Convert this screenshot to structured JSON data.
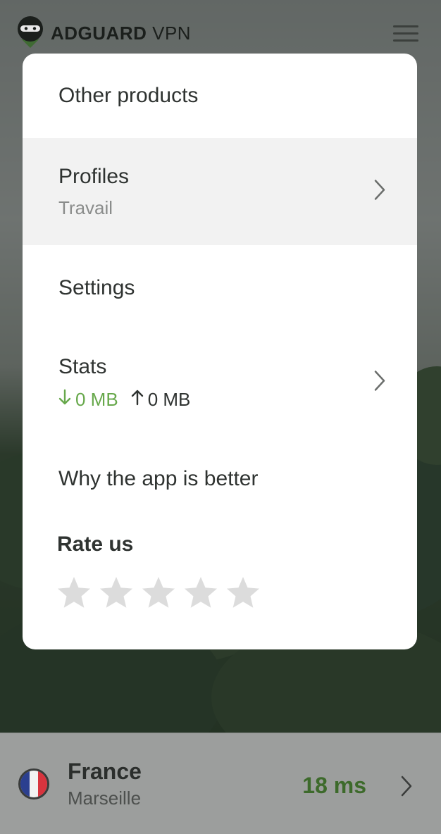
{
  "app": {
    "brand_bold": "ADGUARD",
    "brand_light": "VPN"
  },
  "menu": {
    "other_products": "Other products",
    "profiles": {
      "label": "Profiles",
      "value": "Travail"
    },
    "settings": "Settings",
    "stats": {
      "label": "Stats",
      "download": "0 MB",
      "upload": "0 MB"
    },
    "why_better": "Why the app is better",
    "rate": {
      "label": "Rate us",
      "stars_total": 5,
      "stars_selected": 0
    }
  },
  "location": {
    "country": "France",
    "city": "Marseille",
    "ping": "18 ms"
  },
  "colors": {
    "accent_green": "#67a84b",
    "ping_green": "#3d6a2b",
    "star_grey": "#dcdcdc"
  },
  "icons": [
    "logo-icon",
    "menu-icon",
    "chevron-right-icon",
    "arrow-down-icon",
    "arrow-up-icon",
    "star-icon",
    "france-flag-icon"
  ]
}
